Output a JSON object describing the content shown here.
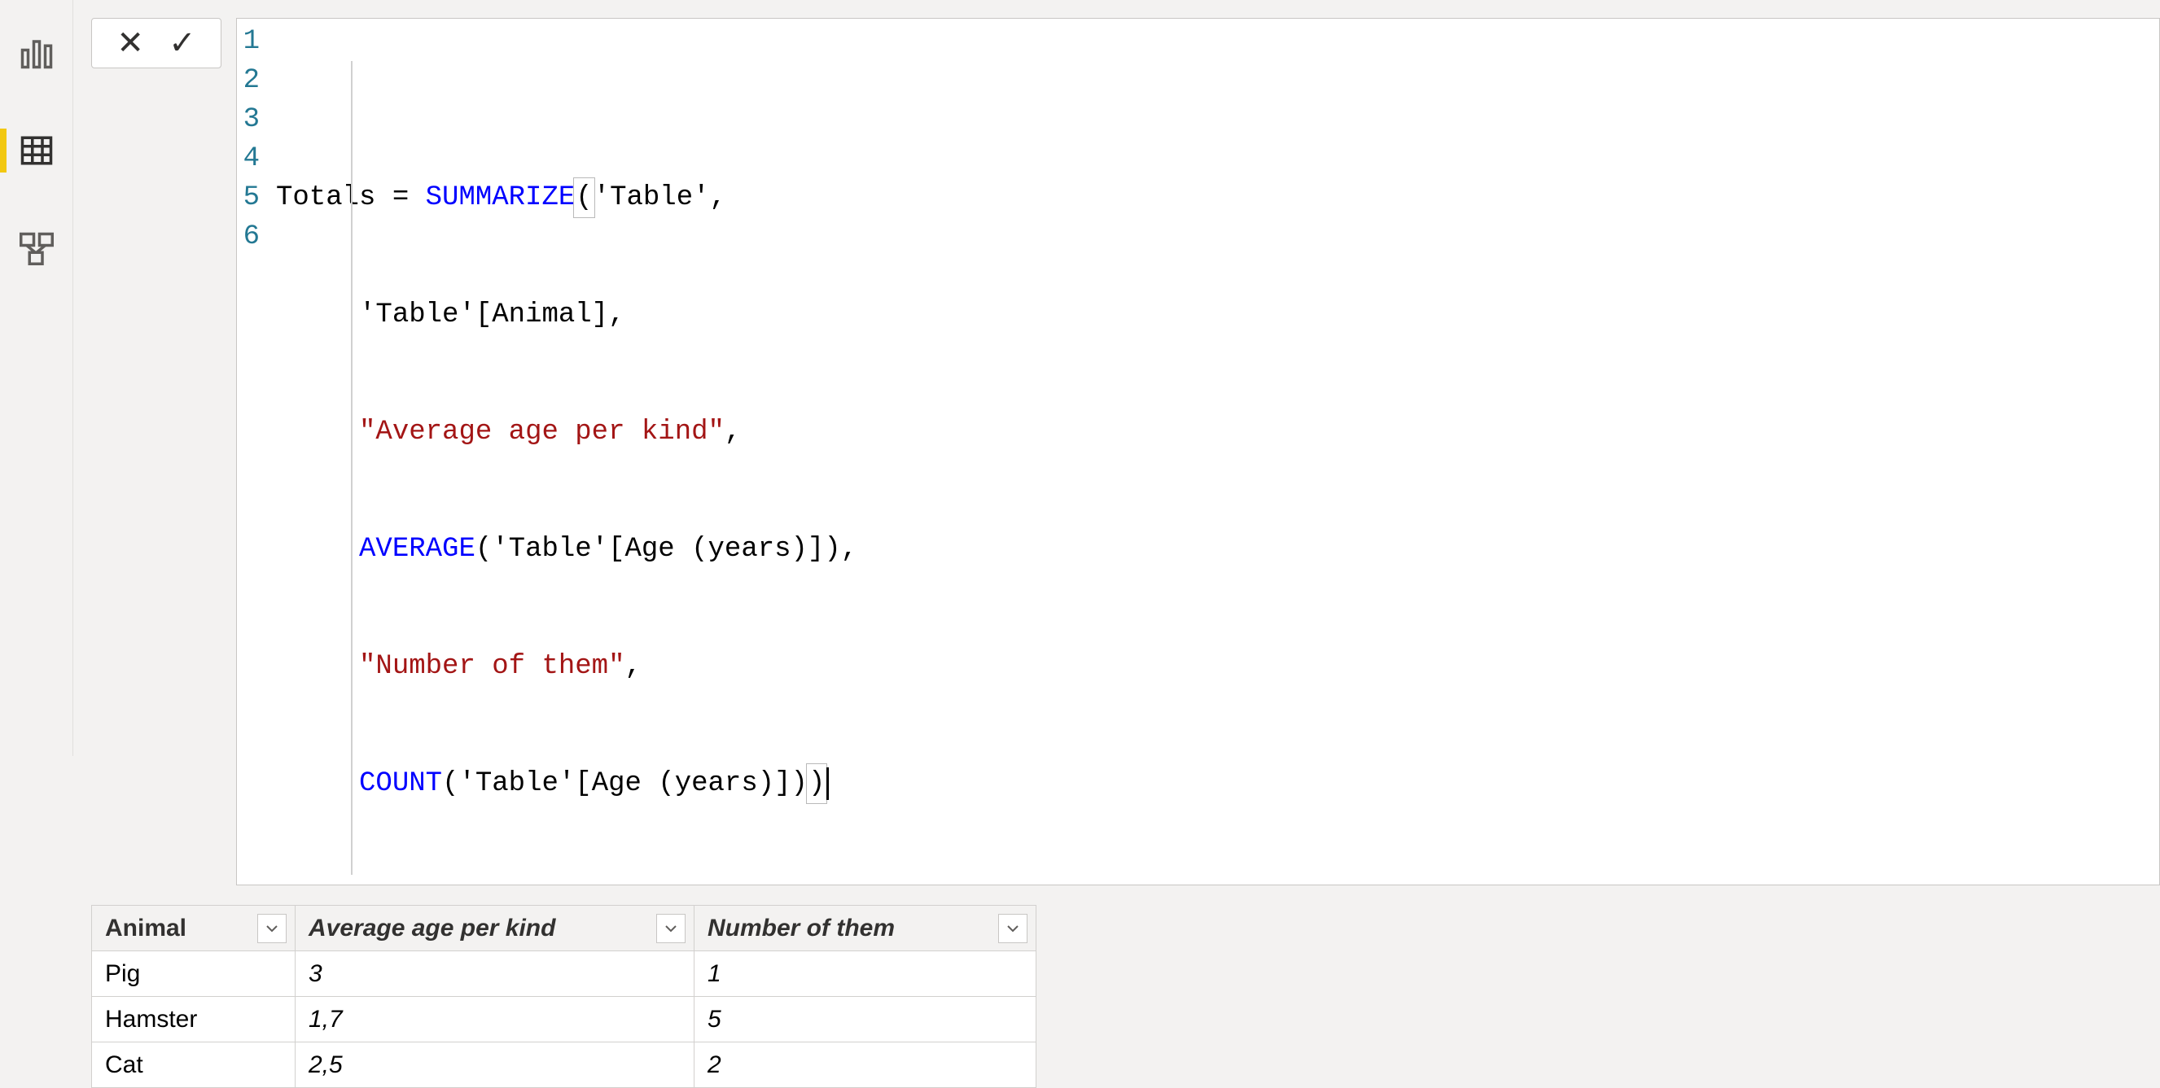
{
  "views": {
    "report_icon": "report",
    "data_icon": "data",
    "model_icon": "model",
    "active": "data"
  },
  "formula_bar": {
    "cancel_glyph": "✕",
    "commit_glyph": "✓",
    "line_numbers": [
      "1",
      "2",
      "3",
      "4",
      "5",
      "6"
    ],
    "lines": {
      "l1": {
        "a": "Totals = ",
        "b": "SUMMARIZE",
        "c": "(",
        "d": "'Table',",
        "bracket_hl": true
      },
      "l2": {
        "indent": "     ",
        "a": "'Table'[Animal],",
        "plain": true
      },
      "l3": {
        "indent": "     ",
        "a": "\"Average age per kind\"",
        "b": ",",
        "string": true
      },
      "l4": {
        "indent": "     ",
        "a": "AVERAGE",
        "b": "('Table'[Age (years)]),"
      },
      "l5": {
        "indent": "     ",
        "a": "\"Number of them\"",
        "b": ",",
        "string": true
      },
      "l6": {
        "indent": "     ",
        "a": "COUNT",
        "b": "('Table'[Age (years)])",
        "c": ")",
        "bracket_hl": true
      }
    }
  },
  "table": {
    "columns": [
      {
        "label": "Animal"
      },
      {
        "label": "Average age per kind"
      },
      {
        "label": "Number of them"
      }
    ],
    "rows": [
      {
        "animal": "Pig",
        "avg": "3",
        "num": "1"
      },
      {
        "animal": "Hamster",
        "avg": "1,7",
        "num": "5"
      },
      {
        "animal": "Cat",
        "avg": "2,5",
        "num": "2"
      }
    ]
  }
}
